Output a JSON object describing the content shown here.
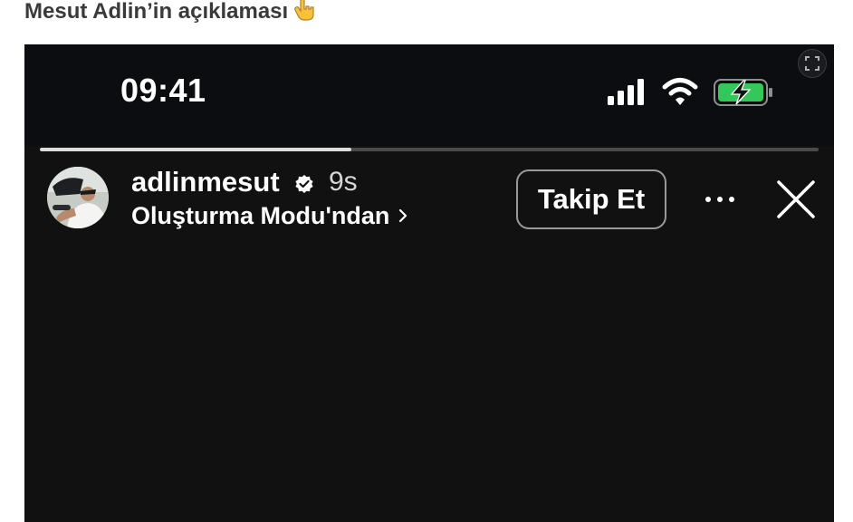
{
  "article": {
    "heading": "Mesut Adlin’in açıklaması",
    "emoji": "👇"
  },
  "story": {
    "status_bar": {
      "time": "09:41",
      "battery_color": "#34c759"
    },
    "progress": 0.4,
    "header": {
      "username": "adlinmesut",
      "time_ago": "9s",
      "source_label": "Oluşturma Modu'ndan",
      "follow_label": "Takip Et"
    }
  }
}
